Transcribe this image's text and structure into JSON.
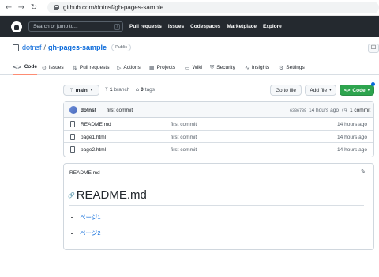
{
  "browser": {
    "back": "←",
    "forward": "→",
    "reload": "↻",
    "url": "github.com/dotnsf/gh-pages-sample"
  },
  "header": {
    "search_placeholder": "Search or jump to...",
    "search_key": "/",
    "nav": [
      "Pull requests",
      "Issues",
      "Codespaces",
      "Marketplace",
      "Explore"
    ]
  },
  "repo": {
    "owner": "dotnsf",
    "separator": "/",
    "name": "gh-pages-sample",
    "visibility": "Public"
  },
  "tabs": [
    {
      "icon": "<>",
      "label": "Code"
    },
    {
      "icon": "⊙",
      "label": "Issues"
    },
    {
      "icon": "⇅",
      "label": "Pull requests"
    },
    {
      "icon": "▷",
      "label": "Actions"
    },
    {
      "icon": "▦",
      "label": "Projects"
    },
    {
      "icon": "▭",
      "label": "Wiki"
    },
    {
      "icon": "⛨",
      "label": "Security"
    },
    {
      "icon": "∿",
      "label": "Insights"
    },
    {
      "icon": "⚙",
      "label": "Settings"
    }
  ],
  "branch_bar": {
    "branch": "main",
    "branch_count": "1",
    "branch_word": "branch",
    "tags_count": "0",
    "tags_word": "tags",
    "go_to_file": "Go to file",
    "add_file": "Add file",
    "code": "Code"
  },
  "latest_commit": {
    "user": "dotnsf",
    "message": "first commit",
    "sha": "6336739",
    "time": "14 hours ago",
    "count": "1 commit"
  },
  "files": [
    {
      "name": "README.md",
      "message": "first commit",
      "time": "14 hours ago"
    },
    {
      "name": "page1.html",
      "message": "first commit",
      "time": "14 hours ago"
    },
    {
      "name": "page2.html",
      "message": "first commit",
      "time": "14 hours ago"
    }
  ],
  "readme": {
    "file_label": "README.md",
    "heading": "README.md",
    "links": [
      "ページ1",
      "ページ2"
    ]
  },
  "colors": {
    "header_bg": "#24292f",
    "link": "#0969da",
    "primary_button": "#2da44e",
    "active_tab_underline": "#fd8c73"
  }
}
